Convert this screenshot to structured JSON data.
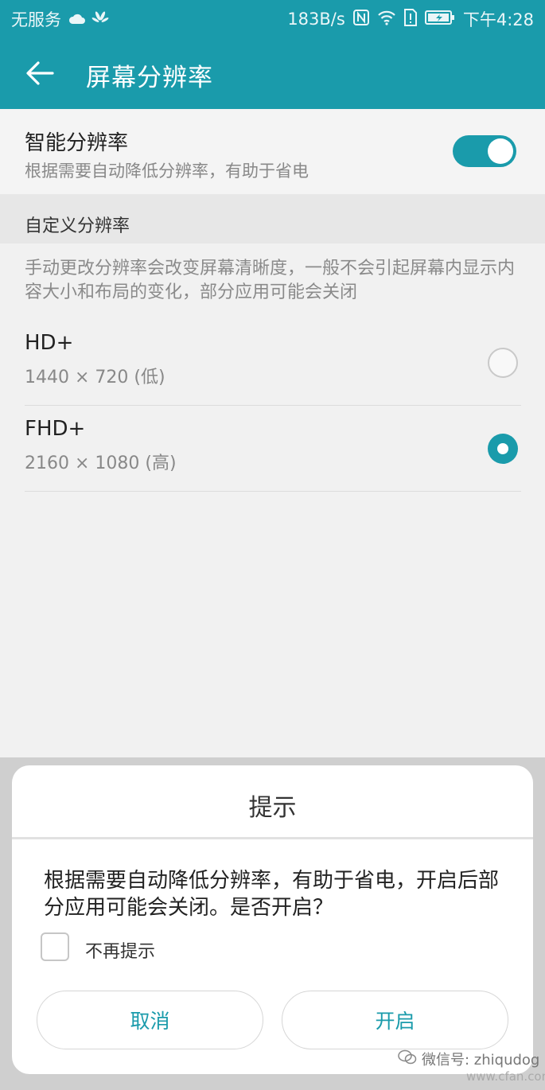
{
  "status_bar": {
    "carrier": "无服务",
    "speed": "183B/s",
    "time": "下午4:28"
  },
  "header": {
    "title": "屏幕分辨率"
  },
  "smart_resolution": {
    "title": "智能分辨率",
    "subtitle": "根据需要自动降低分辨率，有助于省电",
    "enabled": true
  },
  "custom_section": {
    "header": "自定义分辨率",
    "description": "手动更改分辨率会改变屏幕清晰度，一般不会引起屏幕内显示内容大小和布局的变化，部分应用可能会关闭",
    "options": [
      {
        "title": "HD+",
        "subtitle": "1440 × 720 (低)",
        "selected": false
      },
      {
        "title": "FHD+",
        "subtitle": "2160 × 1080 (高)",
        "selected": true
      }
    ]
  },
  "dialog": {
    "title": "提示",
    "message": "根据需要自动降低分辨率，有助于省电，开启后部分应用可能会关闭。是否开启？",
    "checkbox_label": "不再提示",
    "cancel_label": "取消",
    "confirm_label": "开启"
  },
  "watermark": {
    "text": "微信号: zhiqudog",
    "site": "www.cfan.com.cn"
  },
  "colors": {
    "accent": "#1a9bab"
  }
}
